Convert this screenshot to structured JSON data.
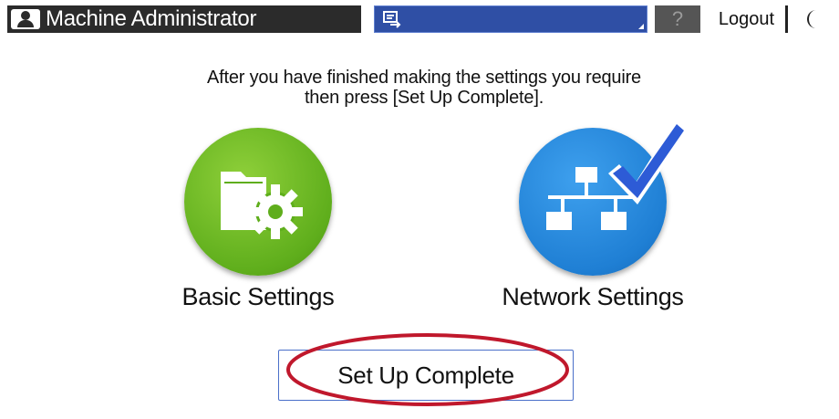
{
  "header": {
    "title": "Machine Administrator",
    "help_label": "?",
    "logout_label": "Logout"
  },
  "main": {
    "instruction_line1": "After you have finished making the settings you require",
    "instruction_line2": "then press [Set Up Complete].",
    "basic_settings_label": "Basic Settings",
    "network_settings_label": "Network Settings",
    "complete_label": "Set Up Complete"
  },
  "colors": {
    "basic_circle": "#5fae1c",
    "network_circle": "#1f7fd4",
    "highlight_ring": "#c0182c",
    "status_bar": "#2f4fa5"
  },
  "icons": [
    "user-icon",
    "screen-status-icon",
    "help-icon",
    "sleep-moon-icon",
    "folder-gear-icon",
    "network-check-icon"
  ]
}
